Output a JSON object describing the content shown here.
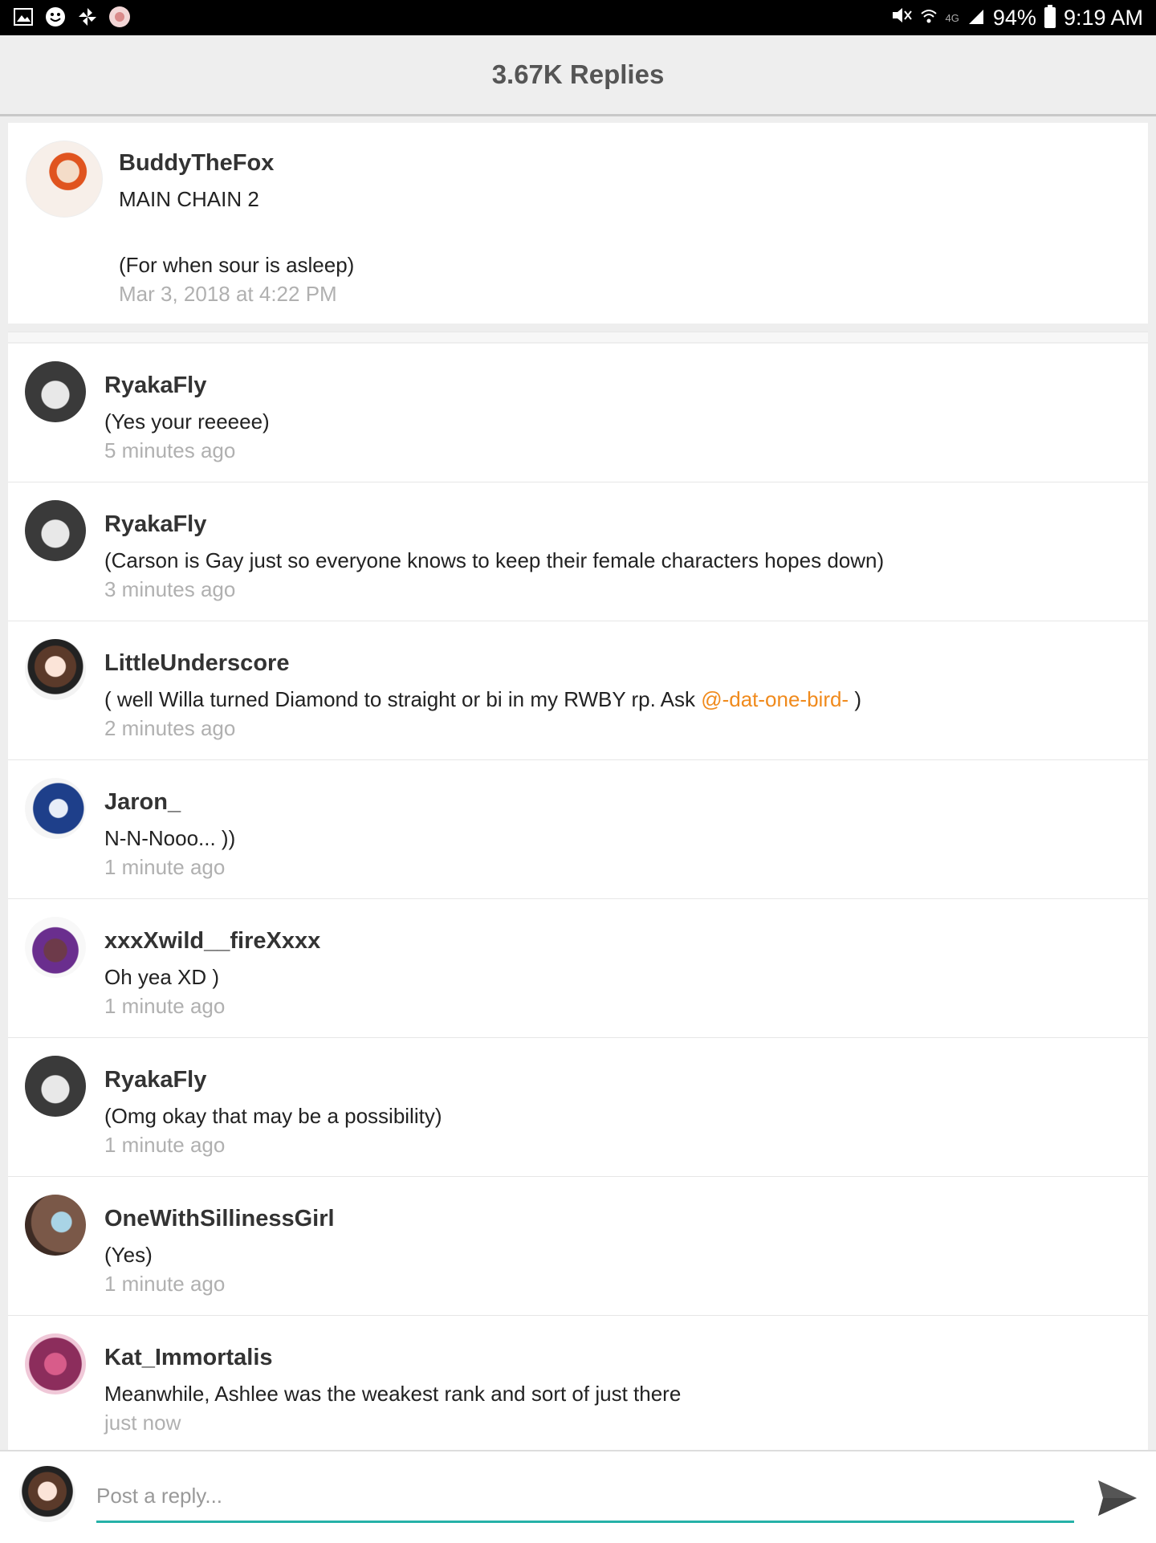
{
  "status_bar": {
    "left_icons": [
      "image-icon",
      "smiley-icon",
      "pinwheel-icon",
      "flower-icon"
    ],
    "network": "4G",
    "battery": "94%",
    "time": "9:19 AM"
  },
  "header": {
    "title": "3.67K Replies"
  },
  "main_post": {
    "author": "BuddyTheFox",
    "title": "MAIN CHAIN 2",
    "body": "(For when sour is asleep)",
    "time": "Mar 3, 2018 at 4:22 PM"
  },
  "replies": [
    {
      "author": "RyakaFly",
      "text": "(Yes your reeeee)",
      "time": "5 minutes ago"
    },
    {
      "author": "RyakaFly",
      "text": "(Carson is Gay just so everyone knows to keep their female characters hopes down)",
      "time": "3 minutes ago"
    },
    {
      "author": "LittleUnderscore",
      "text": "( well Willa turned Diamond to straight or bi in my RWBY rp. Ask ",
      "mention": "@-dat-one-bird-",
      "text_after": " )",
      "time": "2 minutes ago"
    },
    {
      "author": "Jaron_",
      "text": "N-N-Nooo... ))",
      "time": "1 minute ago"
    },
    {
      "author": "xxxXwild__fireXxxx",
      "text": "Oh yea XD )",
      "time": "1 minute ago"
    },
    {
      "author": "RyakaFly",
      "text": "(Omg okay that may be a possibility)",
      "time": "1 minute ago"
    },
    {
      "author": "OneWithSillinessGirl",
      "text": "(Yes)",
      "time": "1 minute ago"
    },
    {
      "author": "Kat_Immortalis",
      "text": "Meanwhile, Ashlee was the weakest rank and sort of just there",
      "time": "just now"
    }
  ],
  "composer": {
    "placeholder": "Post a reply...",
    "value": ""
  },
  "colors": {
    "accent": "#26b1a8",
    "mention": "#f08a1c",
    "timestamp": "#b0b0b0"
  }
}
